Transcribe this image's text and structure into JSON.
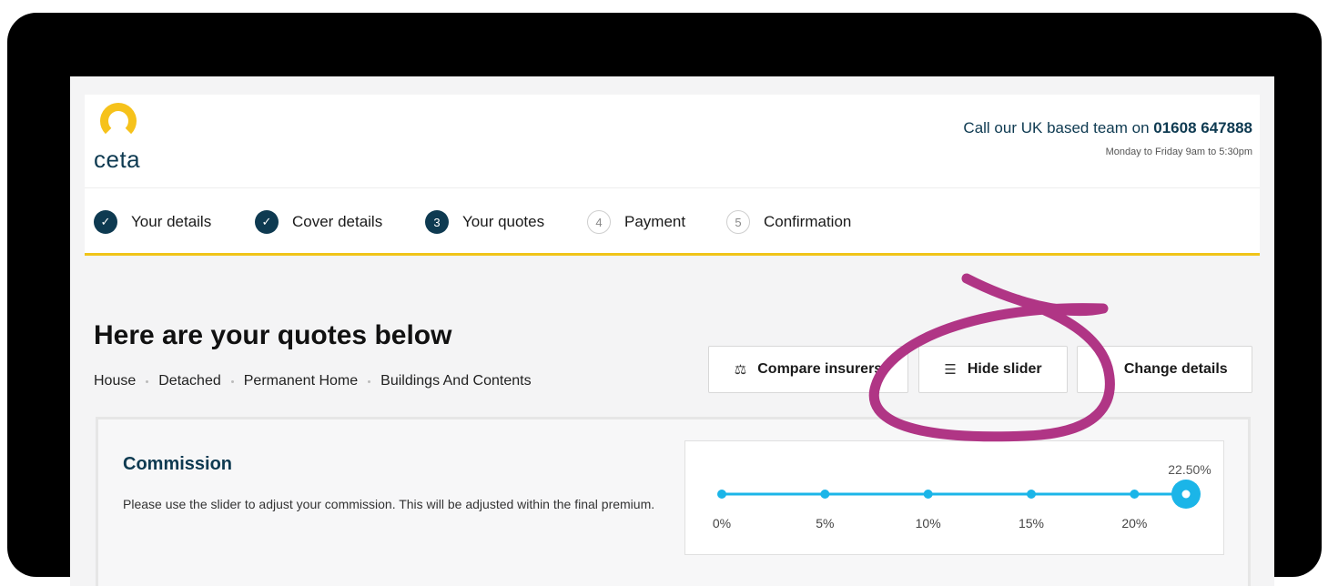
{
  "brand": {
    "logo_text": "ceta",
    "logo_color": "#f6c21b",
    "brand_color": "#0e3a51"
  },
  "header": {
    "call_prefix": "Call our UK based team on ",
    "phone": "01608 647888",
    "hours": "Monday to Friday 9am to 5:30pm"
  },
  "steps": [
    {
      "marker": "✓",
      "label": "Your details",
      "state": "done"
    },
    {
      "marker": "✓",
      "label": "Cover details",
      "state": "done"
    },
    {
      "marker": "3",
      "label": "Your quotes",
      "state": "active"
    },
    {
      "marker": "4",
      "label": "Payment",
      "state": "todo"
    },
    {
      "marker": "5",
      "label": "Confirmation",
      "state": "todo"
    }
  ],
  "page": {
    "title": "Here are your quotes below",
    "breadcrumbs": [
      "House",
      "Detached",
      "Permanent Home",
      "Buildings And Contents"
    ]
  },
  "actions": {
    "compare": {
      "label": "Compare insurers",
      "icon": "scales-icon"
    },
    "hide_slider": {
      "label": "Hide slider",
      "icon": "sliders-icon"
    },
    "change_details": {
      "label": "Change details",
      "icon": "edit-icon"
    }
  },
  "commission": {
    "title": "Commission",
    "description": "Please use the slider to adjust your commission. This will be adjusted within the final premium.",
    "value": 22.5,
    "value_label": "22.50%",
    "min": 0,
    "max": 22.5,
    "ticks": [
      {
        "value": 0,
        "label": "0%"
      },
      {
        "value": 5,
        "label": "5%"
      },
      {
        "value": 10,
        "label": "10%"
      },
      {
        "value": 15,
        "label": "15%"
      },
      {
        "value": 20,
        "label": "20%"
      }
    ],
    "track_color": "#1bb5e8"
  },
  "annotation": {
    "color": "#b03585",
    "shape": "hand-drawn circle around Hide slider button"
  }
}
